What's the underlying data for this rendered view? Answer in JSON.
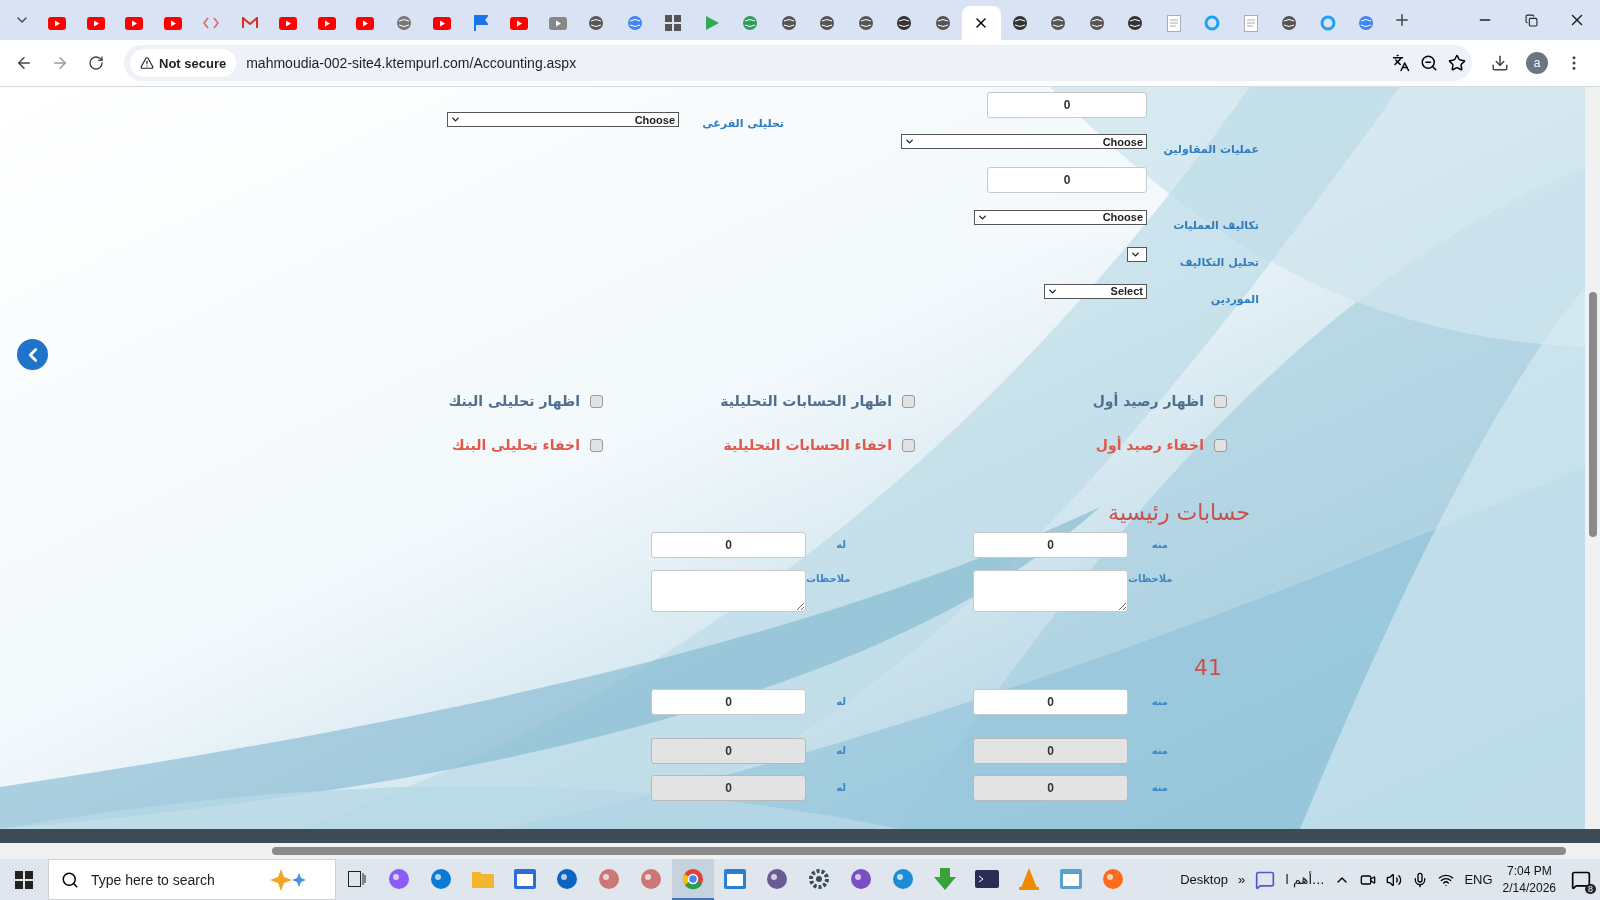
{
  "browser": {
    "tabs": [
      {
        "kind": "youtube",
        "selected": false
      },
      {
        "kind": "youtube",
        "selected": false
      },
      {
        "kind": "youtube",
        "selected": false
      },
      {
        "kind": "youtube",
        "selected": false
      },
      {
        "kind": "code",
        "selected": false
      },
      {
        "kind": "gmail",
        "selected": false
      },
      {
        "kind": "youtube",
        "selected": false
      },
      {
        "kind": "youtube",
        "selected": false
      },
      {
        "kind": "youtube",
        "selected": false
      },
      {
        "kind": "facebook",
        "selected": false
      },
      {
        "kind": "youtube",
        "selected": false
      },
      {
        "kind": "flag",
        "selected": false
      },
      {
        "kind": "youtube",
        "selected": false
      },
      {
        "kind": "video",
        "selected": false
      },
      {
        "kind": "knot",
        "selected": false
      },
      {
        "kind": "google",
        "selected": false
      },
      {
        "kind": "grid",
        "selected": false
      },
      {
        "kind": "play",
        "selected": false
      },
      {
        "kind": "earth",
        "selected": false
      },
      {
        "kind": "globe",
        "selected": false
      },
      {
        "kind": "globe",
        "selected": false
      },
      {
        "kind": "knot",
        "selected": false
      },
      {
        "kind": "swirl",
        "selected": false
      },
      {
        "kind": "globe",
        "selected": false
      },
      {
        "kind": "blank",
        "selected": true
      },
      {
        "kind": "swirl",
        "selected": false
      },
      {
        "kind": "globe",
        "selected": false
      },
      {
        "kind": "globe",
        "selected": false
      },
      {
        "kind": "swirl",
        "selected": false
      },
      {
        "kind": "doc",
        "selected": false
      },
      {
        "kind": "ring",
        "selected": false
      },
      {
        "kind": "doc",
        "selected": false
      },
      {
        "kind": "knot",
        "selected": false
      },
      {
        "kind": "ring",
        "selected": false
      },
      {
        "kind": "google",
        "selected": false
      }
    ],
    "address": {
      "security_label": "Not secure",
      "url": "mahmoudia-002-site4.ktempurl.com/Accounting.aspx",
      "avatar": "a"
    }
  },
  "form": {
    "branch_analysis": {
      "label": "تحليلى الفرغى",
      "value": "Choose"
    },
    "fields": [
      {
        "kind": "input",
        "value": "0"
      },
      {
        "kind": "select",
        "label": "عمليات المقاولين",
        "value": "Choose"
      },
      {
        "kind": "input",
        "value": "0"
      },
      {
        "kind": "select",
        "label": "تكاليف العمليات",
        "value": "Choose"
      },
      {
        "kind": "select",
        "label": "تحليل التكاليف"
      },
      {
        "kind": "select",
        "label": "الموردين",
        "value": "Select"
      }
    ],
    "toggle_rows": [
      {
        "kind": "show",
        "items": [
          {
            "label": "اظهار رصيد أول",
            "checked": false
          },
          {
            "label": "اظهار الحسابات التحليلية",
            "checked": false
          },
          {
            "label": "اظهار تحليلى البنك",
            "checked": false
          }
        ]
      },
      {
        "kind": "hide",
        "items": [
          {
            "label": "اخفاء رصيد أول",
            "checked": false
          },
          {
            "label": "اخفاء الحسابات التحليلية",
            "checked": false
          },
          {
            "label": "اخفاء تحليلى البنك",
            "checked": false
          }
        ]
      }
    ],
    "sections": [
      {
        "title": "حسابات رئيسية",
        "rows": [
          {
            "kind": "amount",
            "disabled": false,
            "cells": [
              {
                "label": "منه",
                "value": "0"
              },
              {
                "label": "له",
                "value": "0"
              }
            ]
          },
          {
            "kind": "notes",
            "cells": [
              {
                "label": "ملاحظات"
              },
              {
                "label": "ملاحظات"
              }
            ]
          }
        ]
      },
      {
        "title": "41",
        "rows": [
          {
            "kind": "amount",
            "disabled": false,
            "cells": [
              {
                "label": "منه",
                "value": "0"
              },
              {
                "label": "له",
                "value": "0"
              }
            ]
          },
          {
            "kind": "amount",
            "disabled": true,
            "cells": [
              {
                "label": "منه",
                "value": "0"
              },
              {
                "label": "له",
                "value": "0"
              }
            ]
          },
          {
            "kind": "amount",
            "disabled": true,
            "cells": [
              {
                "label": "منه",
                "value": "0"
              },
              {
                "label": "له",
                "value": "0"
              }
            ]
          }
        ]
      }
    ]
  },
  "taskbar": {
    "search_placeholder": "Type here to search",
    "apps": [
      {
        "kind": "copilot",
        "selected": false
      },
      {
        "kind": "edge",
        "selected": false
      },
      {
        "kind": "folder",
        "selected": false
      },
      {
        "kind": "store",
        "selected": false
      },
      {
        "kind": "mail",
        "selected": false
      },
      {
        "kind": "palette",
        "selected": false
      },
      {
        "kind": "palette",
        "selected": false
      },
      {
        "kind": "chrome",
        "selected": true
      },
      {
        "kind": "window",
        "selected": false
      },
      {
        "kind": "tools",
        "selected": false
      },
      {
        "kind": "gear",
        "selected": false
      },
      {
        "kind": "vs",
        "selected": false
      },
      {
        "kind": "vscode",
        "selected": false
      },
      {
        "kind": "download",
        "selected": false
      },
      {
        "kind": "terminal",
        "selected": false
      },
      {
        "kind": "cone",
        "selected": false
      },
      {
        "kind": "notepad",
        "selected": false
      },
      {
        "kind": "firefox",
        "selected": false
      }
    ],
    "desktop_label": "Desktop",
    "overflow": "»",
    "pinned_window": "أهم ا...",
    "language": "ENG",
    "time": "7:04 PM",
    "date": "2/14/2026",
    "notifications": "8"
  }
}
